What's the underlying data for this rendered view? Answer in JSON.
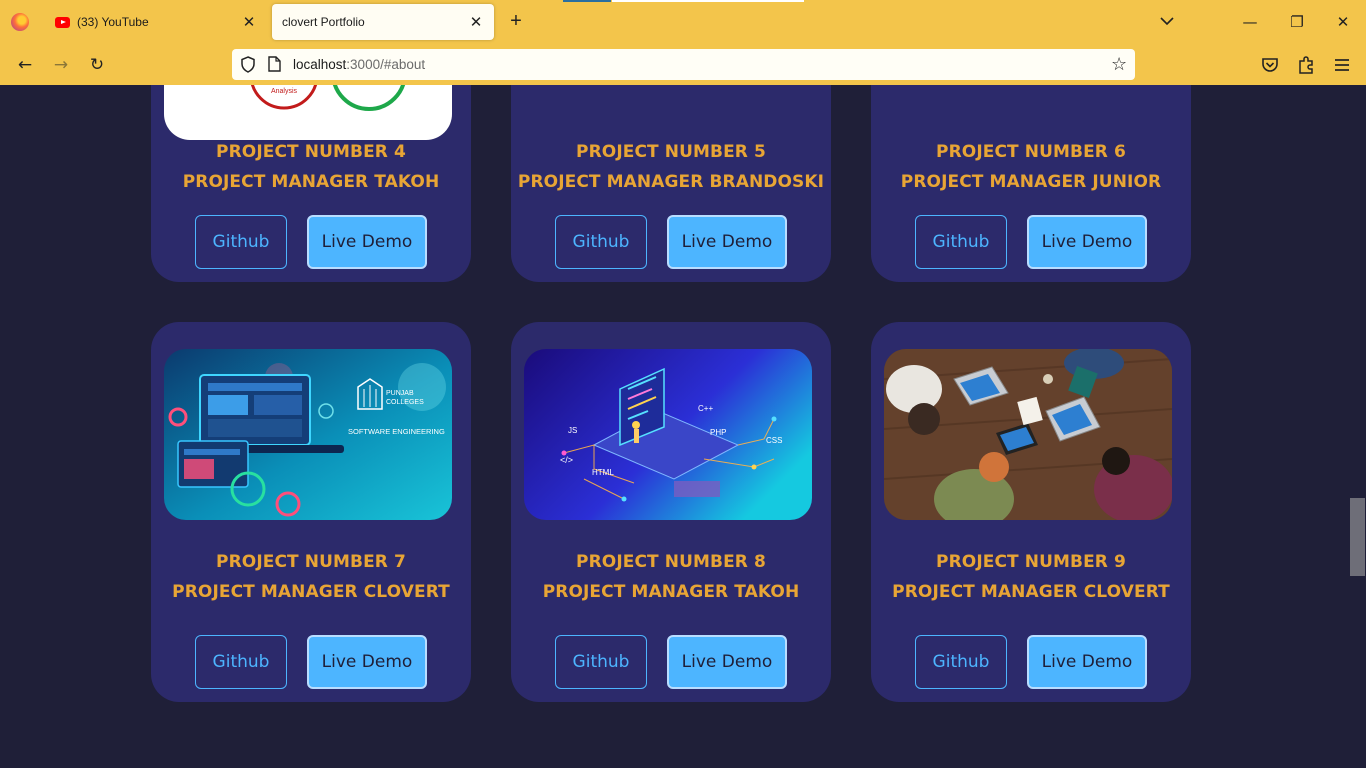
{
  "browser": {
    "tabs": [
      {
        "title": "(33) YouTube",
        "close": "✕"
      },
      {
        "title": "clovert Portfolio",
        "close": "✕"
      }
    ],
    "new_tab": "+",
    "list_tabs": "⌄",
    "window": {
      "minimize": "—",
      "restore": "❐",
      "close": "✕"
    },
    "url_host": "localhost",
    "url_rest": ":3000/#about",
    "back_icon": "←",
    "forward_icon": "→",
    "reload_icon": "↻",
    "star_icon": "☆",
    "pocket_icon": "◡",
    "extensions_icon": "⧉",
    "menu_icon": "≡",
    "accent": "#f3c54b"
  },
  "colors": {
    "page_bg": "#1f1f38",
    "card_bg": "#2c2a6b",
    "title": "#e8a535",
    "button_blue": "#4db5ff"
  },
  "projects": [
    {
      "number_text": "PROJECT NUMBER 4",
      "manager_text": "PROJECT MANAGER TAKOH",
      "github": "Github",
      "demo": "Live Demo"
    },
    {
      "number_text": "PROJECT NUMBER 5",
      "manager_text": "PROJECT MANAGER BRANDOSKI",
      "github": "Github",
      "demo": "Live Demo"
    },
    {
      "number_text": "PROJECT NUMBER 6",
      "manager_text": "PROJECT MANAGER JUNIOR",
      "github": "Github",
      "demo": "Live Demo"
    },
    {
      "number_text": "PROJECT NUMBER 7",
      "manager_text": "PROJECT MANAGER CLOVERT",
      "github": "Github",
      "demo": "Live Demo",
      "image_text": {
        "brand_line1": "PUNJAB",
        "brand_line2": "COLLEGES",
        "caption": "SOFTWARE ENGINEERING"
      }
    },
    {
      "number_text": "PROJECT NUMBER 8",
      "manager_text": "PROJECT MANAGER TAKOH",
      "github": "Github",
      "demo": "Live Demo",
      "image_text": {
        "js": "JS",
        "cpp": "C++",
        "php": "PHP",
        "css": "CSS",
        "html": "HTML",
        "code": "</>"
      }
    },
    {
      "number_text": "PROJECT NUMBER 9",
      "manager_text": "PROJECT MANAGER CLOVERT",
      "github": "Github",
      "demo": "Live Demo"
    }
  ],
  "project4_image_text": "Analysis"
}
